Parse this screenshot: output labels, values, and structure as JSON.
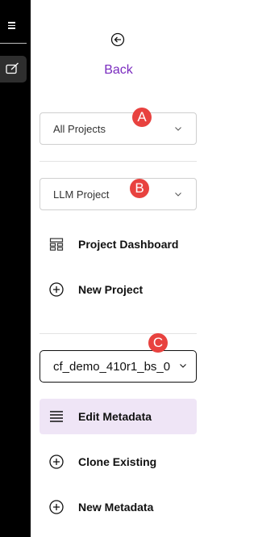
{
  "back": {
    "label": "Back",
    "icon": "arrow-left-circle"
  },
  "filters": {
    "scope_select": {
      "value": "All Projects"
    },
    "project_select": {
      "value": "LLM Project"
    }
  },
  "project_nav": [
    {
      "label": "Project Dashboard",
      "icon": "dashboard-grid"
    },
    {
      "label": "New Project",
      "icon": "plus-circle"
    }
  ],
  "metadata_select": {
    "value": "cf_demo_410r1_bs_0"
  },
  "metadata_nav": [
    {
      "label": "Edit Metadata",
      "icon": "list-lines",
      "active": true
    },
    {
      "label": "Clone Existing",
      "icon": "plus-circle"
    },
    {
      "label": "New Metadata",
      "icon": "plus-circle"
    }
  ],
  "annotations": {
    "a": "A",
    "b": "B",
    "c": "C"
  },
  "colors": {
    "accent": "#7a2bbf",
    "active_bg": "#efe5f6",
    "badge": "#e8423f",
    "rail": "#000000"
  }
}
